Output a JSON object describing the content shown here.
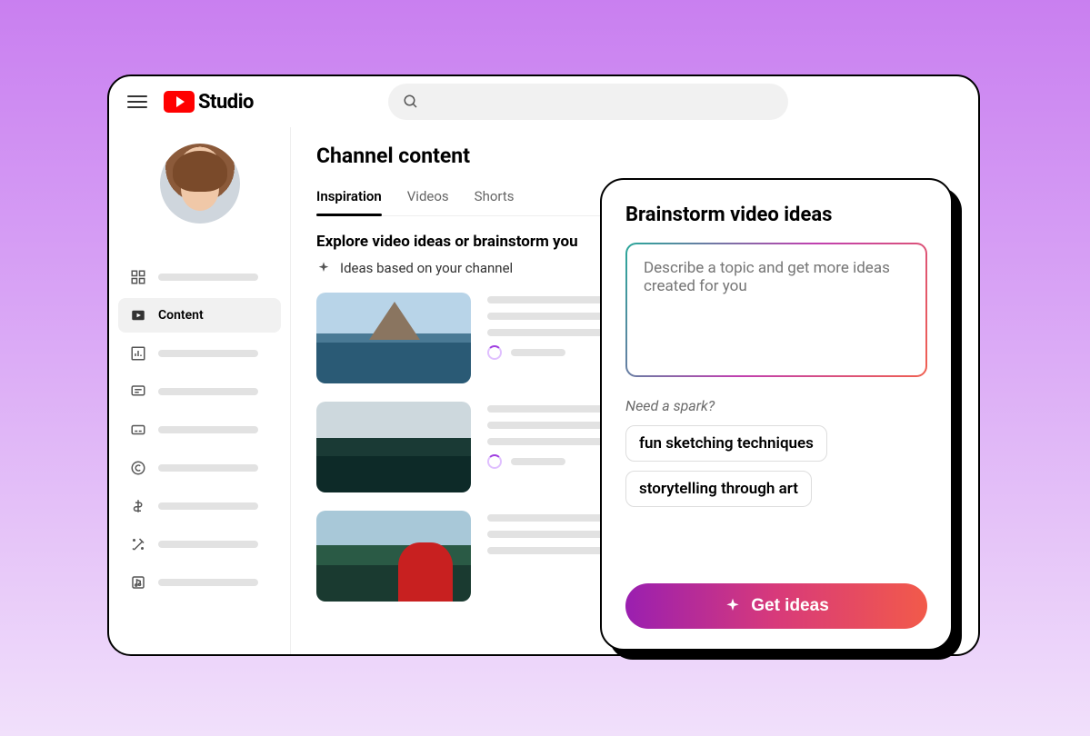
{
  "header": {
    "brand": "Studio",
    "search_placeholder": ""
  },
  "sidebar": {
    "active_label": "Content",
    "items": [
      {
        "icon": "dashboard-icon"
      },
      {
        "icon": "content-icon",
        "label": "Content",
        "active": true
      },
      {
        "icon": "analytics-icon"
      },
      {
        "icon": "comments-icon"
      },
      {
        "icon": "subtitles-icon"
      },
      {
        "icon": "copyright-icon"
      },
      {
        "icon": "earn-icon"
      },
      {
        "icon": "customize-icon"
      },
      {
        "icon": "audio-icon"
      }
    ]
  },
  "main": {
    "title": "Channel content",
    "tabs": [
      {
        "label": "Inspiration",
        "active": true
      },
      {
        "label": "Videos"
      },
      {
        "label": "Shorts"
      }
    ],
    "section_title": "Explore video ideas or brainstorm you",
    "subtitle": "Ideas based on your channel"
  },
  "panel": {
    "title": "Brainstorm video ideas",
    "prompt_placeholder": "Describe a topic and get more ideas created for you",
    "spark_label": "Need a spark?",
    "chips": [
      "fun sketching techniques",
      "storytelling through art"
    ],
    "cta": "Get ideas"
  }
}
